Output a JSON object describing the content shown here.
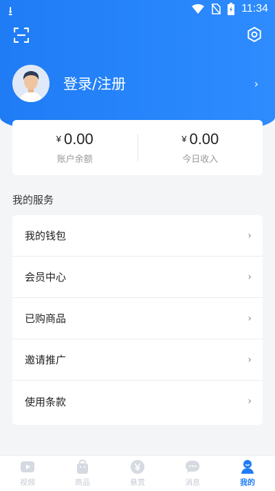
{
  "status_bar": {
    "time": "11:34"
  },
  "profile": {
    "login_label": "登录/注册"
  },
  "balance": {
    "currency_symbol": "¥",
    "account_amount": "0.00",
    "account_label": "账户余额",
    "today_amount": "0.00",
    "today_label": "今日收入"
  },
  "services": {
    "title": "我的服务",
    "items": [
      {
        "label": "我的钱包"
      },
      {
        "label": "会员中心"
      },
      {
        "label": "已购商品"
      },
      {
        "label": "邀请推广"
      },
      {
        "label": "使用条款"
      }
    ]
  },
  "tabbar": {
    "tabs": [
      {
        "label": "视频",
        "icon": "video-icon"
      },
      {
        "label": "商品",
        "icon": "shopping-bag-icon"
      },
      {
        "label": "悬赏",
        "icon": "yuan-coin-icon"
      },
      {
        "label": "消息",
        "icon": "chat-bubble-icon"
      },
      {
        "label": "我的",
        "icon": "user-icon"
      }
    ],
    "active_tab": "我的"
  },
  "colors": {
    "accent": "#1f7cf5",
    "tab_inactive": "#c5cad3",
    "background": "#f4f5f7"
  }
}
